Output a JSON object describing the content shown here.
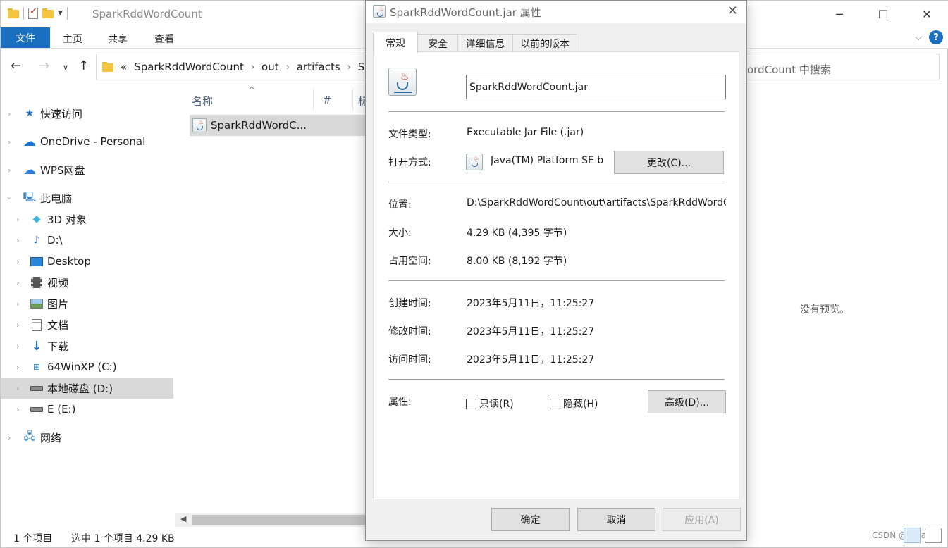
{
  "explorer": {
    "title": "SparkRddWordCount",
    "ribbon_tabs": [
      "文件",
      "主页",
      "共享",
      "查看"
    ],
    "breadcrumb": [
      "«",
      "SparkRddWordCount",
      "out",
      "artifacts",
      "Sp"
    ],
    "search_placeholder": "ordCount 中搜索",
    "sidebar": [
      {
        "label": "快速访问",
        "icon": "star-icon"
      },
      {
        "label": "OneDrive - Personal",
        "icon": "onedrive-icon"
      },
      {
        "label": "WPS网盘",
        "icon": "cloud-icon"
      },
      {
        "label": "此电脑",
        "icon": "computer-icon"
      },
      {
        "label": "3D 对象",
        "icon": "3d-objects-icon"
      },
      {
        "label": "D:\\",
        "icon": "music-icon"
      },
      {
        "label": "Desktop",
        "icon": "desktop-icon"
      },
      {
        "label": "视频",
        "icon": "video-icon"
      },
      {
        "label": "图片",
        "icon": "pictures-icon"
      },
      {
        "label": "文档",
        "icon": "documents-icon"
      },
      {
        "label": "下载",
        "icon": "download-icon"
      },
      {
        "label": "64WinXP  (C:)",
        "icon": "windows-drive-icon"
      },
      {
        "label": "本地磁盘 (D:)",
        "icon": "drive-icon"
      },
      {
        "label": "E (E:)",
        "icon": "drive-icon"
      },
      {
        "label": "网络",
        "icon": "network-icon"
      }
    ],
    "columns": [
      "名称",
      "#",
      "标"
    ],
    "file_name": "SparkRddWordC...",
    "preview_text": "没有预览。",
    "status": {
      "count": "1 个项目",
      "selected": "选中 1 个项目  4.29 KB"
    },
    "watermark": "CSDN @Giyarnu"
  },
  "dialog": {
    "title": "SparkRddWordCount.jar 属性",
    "tabs": [
      "常规",
      "安全",
      "详细信息",
      "以前的版本"
    ],
    "file_name": "SparkRddWordCount.jar",
    "rows": {
      "file_type": {
        "label": "文件类型:",
        "value": "Executable Jar File (.jar)"
      },
      "open_with": {
        "label": "打开方式:",
        "value": "Java(TM) Platform SE b",
        "button": "更改(C)..."
      },
      "location": {
        "label": "位置:",
        "value": "D:\\SparkRddWordCount\\out\\artifacts\\SparkRddWordCount"
      },
      "size": {
        "label": "大小:",
        "value": "4.29 KB (4,395 字节)"
      },
      "size_on_disk": {
        "label": "占用空间:",
        "value": "8.00 KB (8,192 字节)"
      },
      "created": {
        "label": "创建时间:",
        "value": "2023年5月11日，11:25:27"
      },
      "modified": {
        "label": "修改时间:",
        "value": "2023年5月11日，11:25:27"
      },
      "accessed": {
        "label": "访问时间:",
        "value": "2023年5月11日，11:25:27"
      },
      "attributes": {
        "label": "属性:",
        "readonly": "只读(R)",
        "hidden": "隐藏(H)",
        "advanced": "高级(D)..."
      }
    },
    "buttons": {
      "ok": "确定",
      "cancel": "取消",
      "apply": "应用(A)"
    }
  }
}
